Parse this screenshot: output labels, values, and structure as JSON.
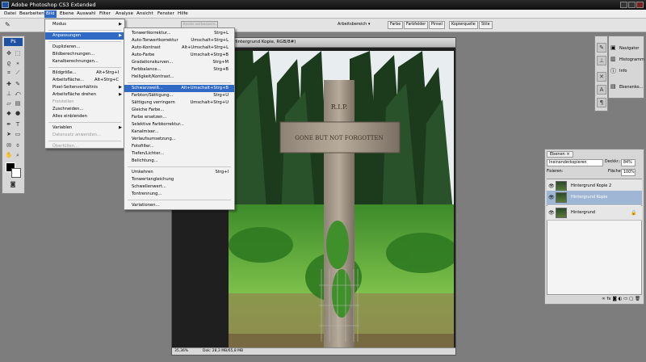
{
  "app": {
    "title": "Adobe Photoshop CS3 Extended"
  },
  "menubar": [
    "Datei",
    "Bearbeiten",
    "Bild",
    "Ebene",
    "Auswahl",
    "Filter",
    "Analyse",
    "Ansicht",
    "Fenster",
    "Hilfe"
  ],
  "optionsbar": {
    "faded_field": "Kante verbessern...",
    "workspace": "Arbeitsbereich ▾",
    "panel_tabs": [
      "Farbe",
      "Farbfelder",
      "Pinsel",
      "Kopierquelle",
      "Stile"
    ]
  },
  "document": {
    "title": "Hintergrund Kopie, RGB/8#)",
    "zoom": "35,36%",
    "doc_info": "Dok: 28,3 MB/65,8 MB"
  },
  "bild_menu": [
    {
      "label": "Modus",
      "arrow": true
    },
    {
      "sep": true
    },
    {
      "label": "Anpassungen",
      "arrow": true,
      "highlight": true
    },
    {
      "sep": true
    },
    {
      "label": "Duplizieren..."
    },
    {
      "label": "Bildberechnungen..."
    },
    {
      "label": "Kanalberechnungen..."
    },
    {
      "sep": true
    },
    {
      "label": "Bildgröße...",
      "shortcut": "Alt+Strg+I"
    },
    {
      "label": "Arbeitsfläche...",
      "shortcut": "Alt+Strg+C"
    },
    {
      "label": "Pixel-Seitenverhältnis",
      "arrow": true
    },
    {
      "label": "Arbeitsfläche drehen",
      "arrow": true
    },
    {
      "label": "Freistellen",
      "disabled": true
    },
    {
      "label": "Zuschneiden..."
    },
    {
      "label": "Alles einblenden"
    },
    {
      "sep": true
    },
    {
      "label": "Variablen",
      "arrow": true
    },
    {
      "label": "Datensatz anwenden...",
      "disabled": true
    },
    {
      "sep": true
    },
    {
      "label": "Überfüllen...",
      "disabled": true
    }
  ],
  "adjust_menu": [
    {
      "label": "Tonwertkorrektur...",
      "shortcut": "Strg+L"
    },
    {
      "label": "Auto-Tonwertkorrektur",
      "shortcut": "Umschalt+Strg+L"
    },
    {
      "label": "Auto-Kontrast",
      "shortcut": "Alt+Umschalt+Strg+L"
    },
    {
      "label": "Auto-Farbe",
      "shortcut": "Umschalt+Strg+B"
    },
    {
      "label": "Gradationskurven...",
      "shortcut": "Strg+M"
    },
    {
      "label": "Farbbalance...",
      "shortcut": "Strg+B"
    },
    {
      "label": "Helligkeit/Kontrast..."
    },
    {
      "sep": true
    },
    {
      "label": "Schwarzweiß...",
      "shortcut": "Alt+Umschalt+Strg+B",
      "highlight": true
    },
    {
      "label": "Farbton/Sättigung...",
      "shortcut": "Strg+U"
    },
    {
      "label": "Sättigung verringern",
      "shortcut": "Umschalt+Strg+U"
    },
    {
      "label": "Gleiche Farbe..."
    },
    {
      "label": "Farbe ersetzen..."
    },
    {
      "label": "Selektive Farbkorrektur..."
    },
    {
      "label": "Kanalmixer..."
    },
    {
      "label": "Verlaufsumsetzung..."
    },
    {
      "label": "Fotofilter..."
    },
    {
      "label": "Tiefen/Lichter..."
    },
    {
      "label": "Belichtung..."
    },
    {
      "sep": true
    },
    {
      "label": "Umkehren",
      "shortcut": "Strg+I"
    },
    {
      "label": "Tonwertangleichung"
    },
    {
      "label": "Schwellenwert..."
    },
    {
      "label": "Tontrennung..."
    },
    {
      "sep": true
    },
    {
      "label": "Variationen..."
    }
  ],
  "photo": {
    "sign_top": "R.I.P.",
    "sign_bar": "GONE BUT NOT FORGOTTEN"
  },
  "navigator_panel": {
    "items": [
      "Navigator",
      "Histogramm",
      "Info"
    ]
  },
  "ebenen_small": {
    "label": "Ebenenko..."
  },
  "layers_panel": {
    "tab": "Ebenen ×",
    "blend_mode": "Ineinanderkopieren",
    "opacity_label": "Deckkr.:",
    "opacity_value": "84%",
    "lock_label": "Fixieren:",
    "fill_label": "Fläche:",
    "fill_value": "100%",
    "layers": [
      {
        "name": "Hintergrund Kopie 2",
        "selected": false
      },
      {
        "name": "Hintergrund Kopie",
        "selected": true
      },
      {
        "name": "Hintergrund",
        "selected": false
      }
    ]
  },
  "colors": {
    "highlight": "#316ac5",
    "menu_bg": "#f2f2f2"
  }
}
